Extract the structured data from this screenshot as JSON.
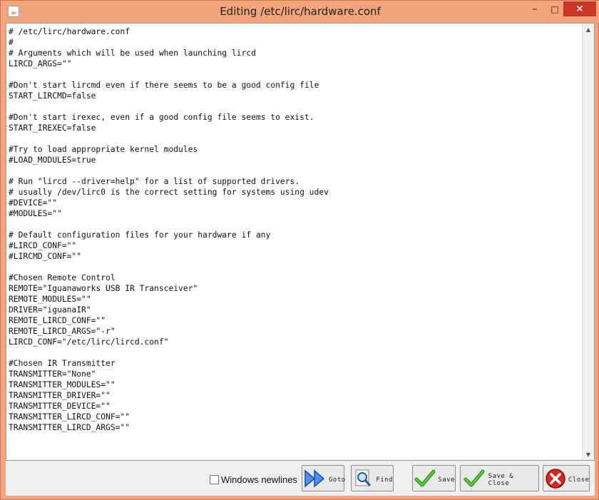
{
  "window": {
    "title": "Editing /etc/lirc/hardware.conf",
    "app_icon": "java-icon",
    "controls": {
      "minimize": "–",
      "maximize": "□",
      "close": "✕"
    }
  },
  "editor": {
    "lines": [
      "# /etc/lirc/hardware.conf",
      "#",
      "# Arguments which will be used when launching lircd",
      "LIRCD_ARGS=\"\"",
      "",
      "#Don't start lircmd even if there seems to be a good config file",
      "START_LIRCMD=false",
      "",
      "#Don't start irexec, even if a good config file seems to exist.",
      "START_IREXEC=false",
      "",
      "#Try to load appropriate kernel modules",
      "#LOAD_MODULES=true",
      "",
      "# Run \"lircd --driver=help\" for a list of supported drivers.",
      "# usually /dev/lirc0 is the correct setting for systems using udev",
      "#DEVICE=\"\"",
      "#MODULES=\"\"",
      "",
      "# Default configuration files for your hardware if any",
      "#LIRCD_CONF=\"\"",
      "#LIRCMD_CONF=\"\"",
      "",
      "#Chosen Remote Control",
      "REMOTE=\"Iguanaworks USB IR Transceiver\"",
      "REMOTE_MODULES=\"\"",
      "DRIVER=\"iguanaIR\"",
      "REMOTE_LIRCD_CONF=\"\"",
      "REMOTE_LIRCD_ARGS=\"-r\"",
      "LIRCD_CONF=\"/etc/lirc/lircd.conf\"",
      "",
      "#Chosen IR Transmitter",
      "TRANSMITTER=\"None\"",
      "TRANSMITTER_MODULES=\"\"",
      "TRANSMITTER_DRIVER=\"\"",
      "TRANSMITTER_DEVICE=\"\"",
      "TRANSMITTER_LIRCD_CONF=\"\"",
      "TRANSMITTER_LIRCD_ARGS=\"\""
    ]
  },
  "toolbar": {
    "windows_newlines_label": "Windows newlines",
    "windows_newlines_checked": false,
    "goto_label": "Goto",
    "find_label": "Find",
    "save_label": "Save",
    "save_close_label": "Save & Close",
    "close_label": "Close"
  },
  "colors": {
    "title_bar": "#f2a379",
    "close_button": "#c7382b",
    "check_green": "#3fae2a",
    "goto_blue": "#2f6fd6"
  }
}
